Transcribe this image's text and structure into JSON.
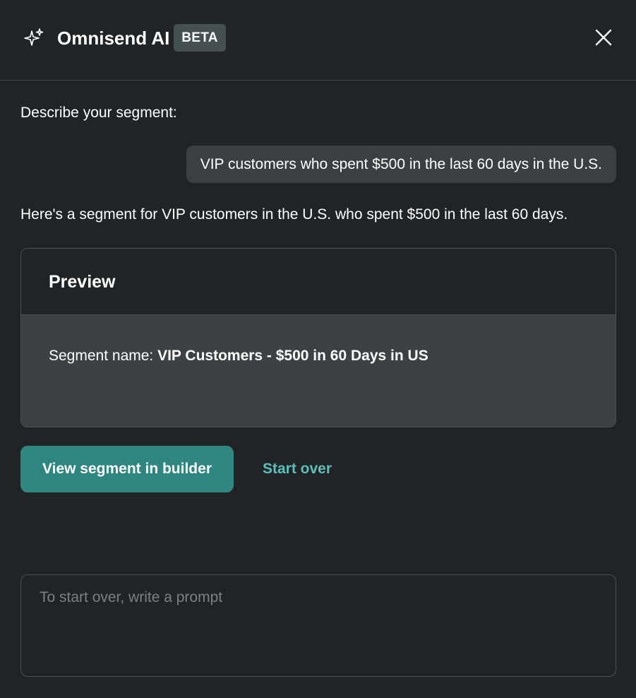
{
  "header": {
    "title": "Omnisend AI",
    "badge": "BETA",
    "sparkle_icon": "sparkle-icon",
    "close_icon": "close-icon"
  },
  "conversation": {
    "prompt_label": "Describe your segment:",
    "user_message": "VIP customers who spent $500 in the last 60 days in the U.S.",
    "ai_message": "Here's a segment for VIP customers in the U.S. who spent $500 in the last 60 days."
  },
  "preview": {
    "title": "Preview",
    "segment_label": "Segment name:",
    "segment_name": "VIP Customers - $500 in 60 Days in US"
  },
  "actions": {
    "view_builder_label": "View segment in builder",
    "start_over_label": "Start over"
  },
  "input": {
    "value": "",
    "placeholder": "To start over, write a prompt"
  },
  "colors": {
    "background": "#202426",
    "accent": "#2f8580",
    "link": "#5cc0b8",
    "badge": "#465052"
  }
}
